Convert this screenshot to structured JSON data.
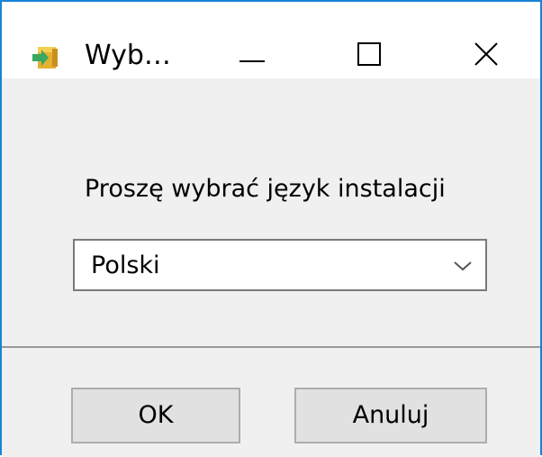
{
  "window": {
    "title": "Wyb…",
    "accent_color": "#1883d7",
    "icon": "installer-arrow-icon"
  },
  "title_controls": {
    "minimize_icon": "minimize-icon",
    "maximize_icon": "maximize-icon",
    "close_icon": "close-icon"
  },
  "content": {
    "prompt": "Proszę wybrać język instalacji",
    "language_select": {
      "selected": "Polski",
      "arrow_icon": "chevron-down-icon"
    }
  },
  "buttons": {
    "ok_label": "OK",
    "cancel_label": "Anuluj"
  }
}
